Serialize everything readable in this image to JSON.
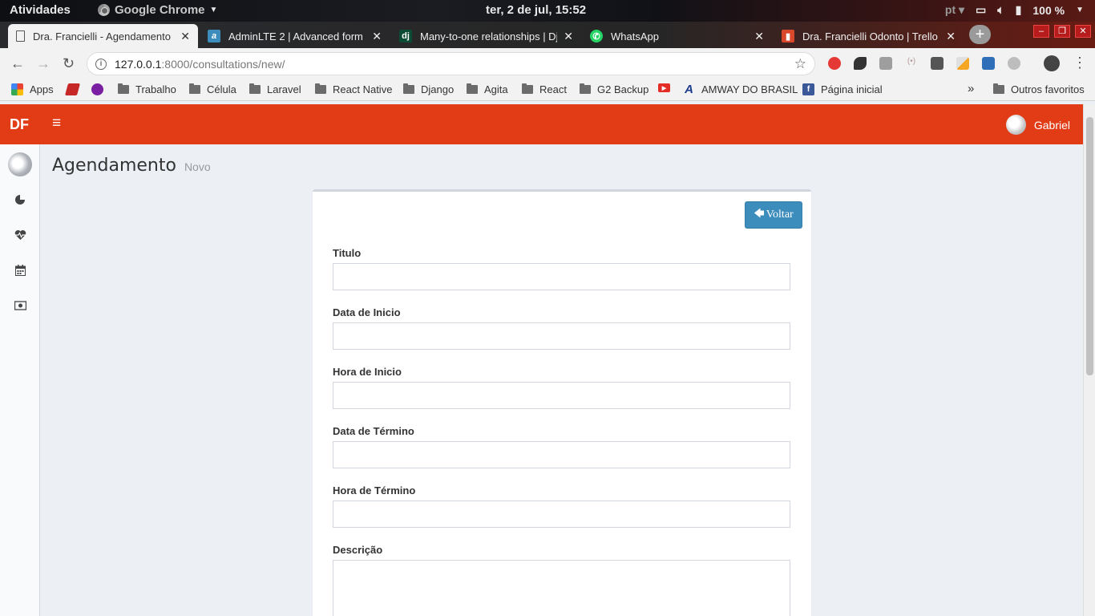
{
  "os": {
    "activities": "Atividades",
    "app_name": "Google Chrome",
    "clock": "ter,  2 de jul, 15:52",
    "lang": "pt",
    "battery": "100 %"
  },
  "tabs": [
    {
      "label": "Dra. Francielli - Agendamento",
      "icon": "page-icon",
      "active": true
    },
    {
      "label": "AdminLTE 2 | Advanced form e",
      "icon": "adminlte-icon"
    },
    {
      "label": "Many-to-one relationships | Dj",
      "icon": "django-icon"
    },
    {
      "label": "WhatsApp",
      "icon": "whatsapp-icon"
    },
    {
      "label": "Dra. Francielli Odonto | Trello",
      "icon": "trello-icon"
    }
  ],
  "address": {
    "host": "127.0.0.1",
    "path": ":8000/consultations/new/"
  },
  "bookmarks": [
    {
      "label": "Apps",
      "type": "apps"
    },
    {
      "label": "",
      "type": "ext"
    },
    {
      "label": "",
      "type": "ext"
    },
    {
      "label": "Trabalho",
      "type": "folder"
    },
    {
      "label": "Célula",
      "type": "folder"
    },
    {
      "label": "Laravel",
      "type": "folder"
    },
    {
      "label": "React Native",
      "type": "folder"
    },
    {
      "label": "Django",
      "type": "folder"
    },
    {
      "label": "Agita",
      "type": "folder"
    },
    {
      "label": "React",
      "type": "folder"
    },
    {
      "label": "G2 Backup",
      "type": "folder"
    },
    {
      "label": "",
      "type": "youtube"
    },
    {
      "label": "AMWAY DO BRASIL",
      "type": "amway"
    },
    {
      "label": "Página inicial",
      "type": "facebook"
    }
  ],
  "bookmarks_more": "»",
  "other_bookmarks": "Outros favoritos",
  "header": {
    "logo": "DF",
    "user_name": "Gabriel",
    "brand_color": "#e23c17"
  },
  "page": {
    "title": "Agendamento",
    "subtitle": "Novo",
    "back_button": "Voltar"
  },
  "form": {
    "fields": [
      {
        "label": "Titulo",
        "value": ""
      },
      {
        "label": "Data de Inicio",
        "value": ""
      },
      {
        "label": "Hora de Inicio",
        "value": ""
      },
      {
        "label": "Data de Término",
        "value": ""
      },
      {
        "label": "Hora de Término",
        "value": ""
      },
      {
        "label": "Descrição",
        "value": ""
      }
    ]
  }
}
